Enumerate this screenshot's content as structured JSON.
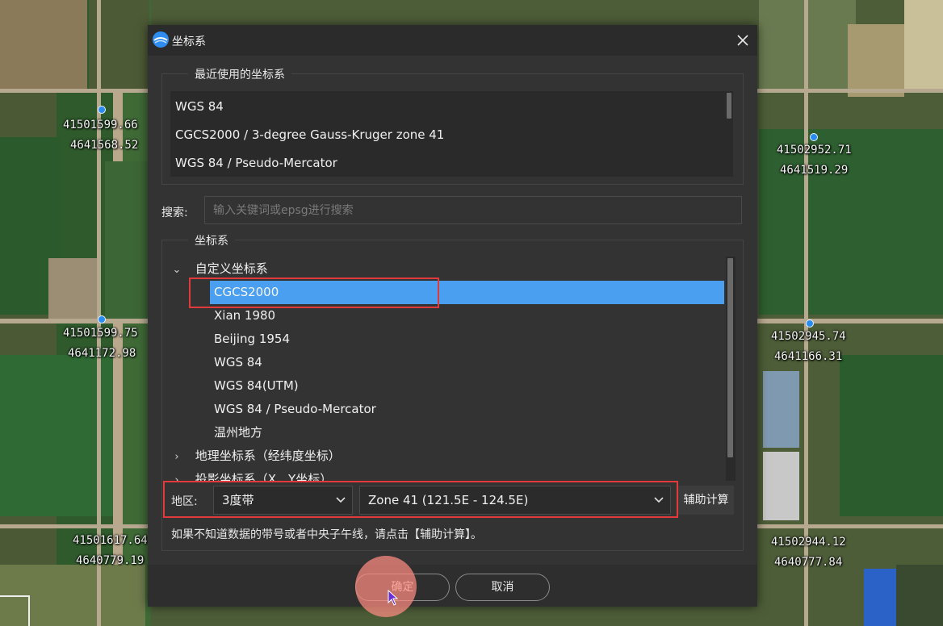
{
  "map": {
    "points": [
      {
        "e": "41501599.66",
        "n": "4641568.52"
      },
      {
        "e": "41501599.75",
        "n": "4641172.98"
      },
      {
        "e": "41501617.64",
        "n": "4640779.19"
      },
      {
        "e": "41502952.71",
        "n": "4641519.29"
      },
      {
        "e": "41502945.74",
        "n": "4641166.31"
      },
      {
        "e": "41502944.12",
        "n": "4640777.84"
      }
    ]
  },
  "dialog": {
    "title": "坐标系",
    "close_icon": "close-icon",
    "recent": {
      "legend": "最近使用的坐标系",
      "items": [
        "WGS 84",
        "CGCS2000 / 3-degree Gauss-Kruger zone 41",
        "WGS 84 / Pseudo-Mercator"
      ]
    },
    "search": {
      "label": "搜索:",
      "placeholder": "输入关键词或epsg进行搜索"
    },
    "crs": {
      "legend": "坐标系",
      "groups": [
        {
          "label": "自定义坐标系",
          "expanded": true,
          "children": [
            "CGCS2000",
            "Xian 1980",
            "Beijing 1954",
            "WGS 84",
            "WGS 84(UTM)",
            "WGS 84 / Pseudo-Mercator",
            "温州地方"
          ],
          "selected": "CGCS2000"
        },
        {
          "label": "地理坐标系（经纬度坐标）",
          "expanded": false
        },
        {
          "label": "投影坐标系（X，Y坐标）",
          "expanded": false
        }
      ]
    },
    "region": {
      "label": "地区:",
      "band": "3度带",
      "zone": "Zone 41 (121.5E - 124.5E)",
      "aux_button": "辅助计算"
    },
    "hint": "如果不知道数据的带号或者中央子午线，请点击【辅助计算】。",
    "ok": "确定",
    "cancel": "取消"
  },
  "colors": {
    "selection": "#4a9ff0",
    "highlight_box": "#e23a3a",
    "marker": "#2a8cf0"
  }
}
